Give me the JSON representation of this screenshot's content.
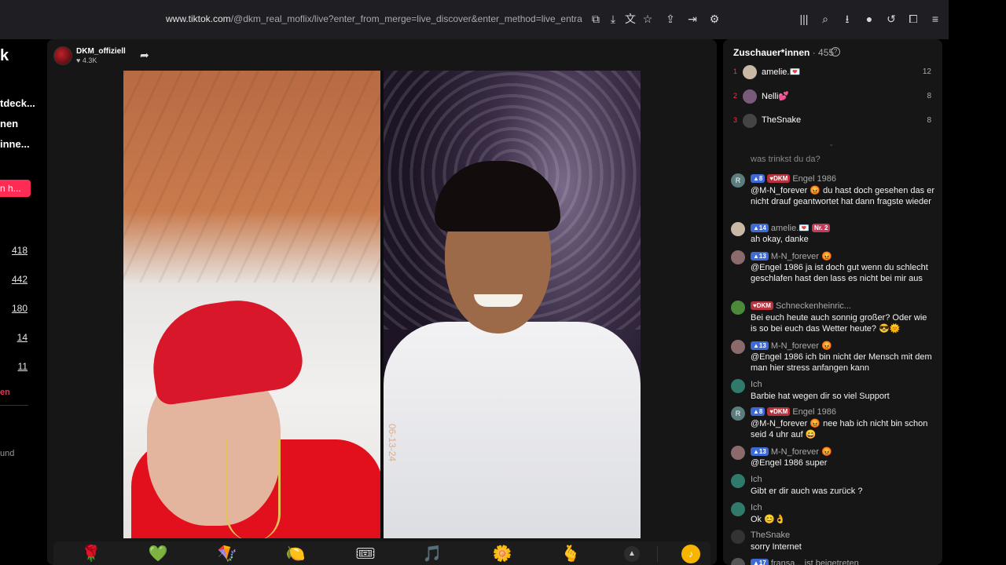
{
  "browser": {
    "url_domain": "www.tiktok.com",
    "url_rest": "/@dkm_real_moflix/live?enter_from_merge=live_discover&enter_method=live_entrance_hover_li..."
  },
  "sidebar": {
    "logo": "k",
    "items": [
      "tdeck...",
      "nen",
      "inne..."
    ],
    "button": "n h...",
    "counts": [
      "418",
      "442",
      "180",
      "14",
      "11"
    ],
    "red_link": "en",
    "footer": [
      "und"
    ]
  },
  "live": {
    "host_name": "DKM_offiziell",
    "host_likes": "♥ 4.3K",
    "date_stamp": "06-13-24",
    "gifts": [
      "🌹",
      "💚",
      "🪁",
      "🍋",
      "🎟",
      "🎵",
      "🌼",
      "🫰"
    ]
  },
  "chat": {
    "viewers_label": "Zuschauer*innen",
    "viewers_count": "· 455",
    "top": [
      {
        "rank": "1",
        "name": "amelie.💌",
        "score": "12"
      },
      {
        "rank": "2",
        "name": "Nelli💕",
        "score": "8"
      },
      {
        "rank": "3",
        "name": "TheSnake",
        "score": "8"
      }
    ],
    "system_text": "was trinkst du da?",
    "messages": [
      {
        "avatar": "R",
        "badges": [
          "▲8",
          "♥DKM"
        ],
        "user": "Engel 1986",
        "text": "@M-N_forever 😡 du hast doch gesehen das er nicht drauf geantwortet hat dann fragste wieder"
      },
      {
        "avatar": "",
        "badges": [
          "▲14"
        ],
        "user": "amelie.💌",
        "extra": "Nr. 2",
        "text": "ah okay, danke"
      },
      {
        "avatar": "",
        "badges": [
          "▲13"
        ],
        "user": "M-N_forever 😡",
        "text": "@Engel 1986 ja ist doch gut wenn du schlecht geschlafen hast den lass es nicht bei mir aus"
      },
      {
        "avatar": "",
        "badges": [
          "♥DKM"
        ],
        "user": "Schneckenheinric...",
        "text": "Bei euch heute auch sonnig großer? Oder wie is so bei euch das Wetter heute? 😎🌞"
      },
      {
        "avatar": "",
        "badges": [
          "▲13"
        ],
        "user": "M-N_forever 😡",
        "text": "@Engel 1986 ich bin nicht der Mensch mit dem man hier stress anfangen kann"
      },
      {
        "avatar": "",
        "badges": [],
        "user": "Ich",
        "text": "Barbie hat wegen dir so viel Support"
      },
      {
        "avatar": "R",
        "badges": [
          "▲8",
          "♥DKM"
        ],
        "user": "Engel 1986",
        "text": "@M-N_forever 😡 nee hab ich nicht bin schon seid 4 uhr auf 😄"
      },
      {
        "avatar": "",
        "badges": [
          "▲13"
        ],
        "user": "M-N_forever 😡",
        "text": "@Engel 1986 super"
      },
      {
        "avatar": "",
        "badges": [],
        "user": "Ich",
        "text": "Gibt er dir auch was zurück ?"
      },
      {
        "avatar": "",
        "badges": [],
        "user": "Ich",
        "text": "Ok 😊👌"
      },
      {
        "avatar": "",
        "badges": [],
        "user": "TheSnake",
        "text": "sorry Internet"
      },
      {
        "avatar": "",
        "badges": [
          "▲17"
        ],
        "user": "fransa...",
        "text": "ist beigetreten"
      }
    ]
  }
}
